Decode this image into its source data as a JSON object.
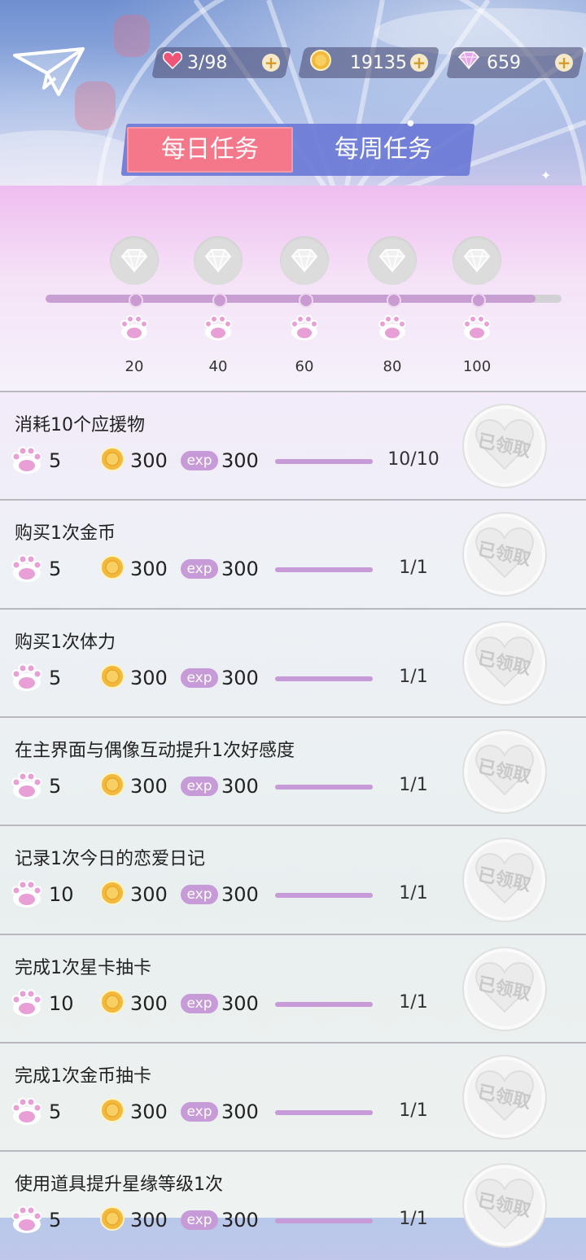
{
  "header": {
    "hearts": "3/98",
    "coins": "19135",
    "gems": "659"
  },
  "tabs": {
    "daily": "每日任务",
    "weekly": "每周任务"
  },
  "progress": {
    "fill_fraction": 0.95,
    "milestones": [
      "20",
      "40",
      "60",
      "80",
      "100"
    ]
  },
  "tasks": [
    {
      "title": "消耗10个应援物",
      "paw": "5",
      "coin": "300",
      "exp_label": "exp",
      "exp": "300",
      "progress": "10/10",
      "fill": 1.0,
      "status": "已领取"
    },
    {
      "title": "购买1次金币",
      "paw": "5",
      "coin": "300",
      "exp_label": "exp",
      "exp": "300",
      "progress": "1/1",
      "fill": 1.0,
      "status": "已领取"
    },
    {
      "title": "购买1次体力",
      "paw": "5",
      "coin": "300",
      "exp_label": "exp",
      "exp": "300",
      "progress": "1/1",
      "fill": 1.0,
      "status": "已领取"
    },
    {
      "title": "在主界面与偶像互动提升1次好感度",
      "paw": "5",
      "coin": "300",
      "exp_label": "exp",
      "exp": "300",
      "progress": "1/1",
      "fill": 1.0,
      "status": "已领取"
    },
    {
      "title": "记录1次今日的恋爱日记",
      "paw": "10",
      "coin": "300",
      "exp_label": "exp",
      "exp": "300",
      "progress": "1/1",
      "fill": 1.0,
      "status": "已领取"
    },
    {
      "title": "完成1次星卡抽卡",
      "paw": "10",
      "coin": "300",
      "exp_label": "exp",
      "exp": "300",
      "progress": "1/1",
      "fill": 1.0,
      "status": "已领取"
    },
    {
      "title": "完成1次金币抽卡",
      "paw": "5",
      "coin": "300",
      "exp_label": "exp",
      "exp": "300",
      "progress": "1/1",
      "fill": 1.0,
      "status": "已领取"
    },
    {
      "title": "使用道具提升星缘等级1次",
      "paw": "5",
      "coin": "300",
      "exp_label": "exp",
      "exp": "300",
      "progress": "1/1",
      "fill": 1.0,
      "status": "已领取"
    }
  ],
  "colors": {
    "accent_pink": "#f4778a",
    "tab_blue": "#6b79d6",
    "bar_purple": "#c79ad8"
  }
}
